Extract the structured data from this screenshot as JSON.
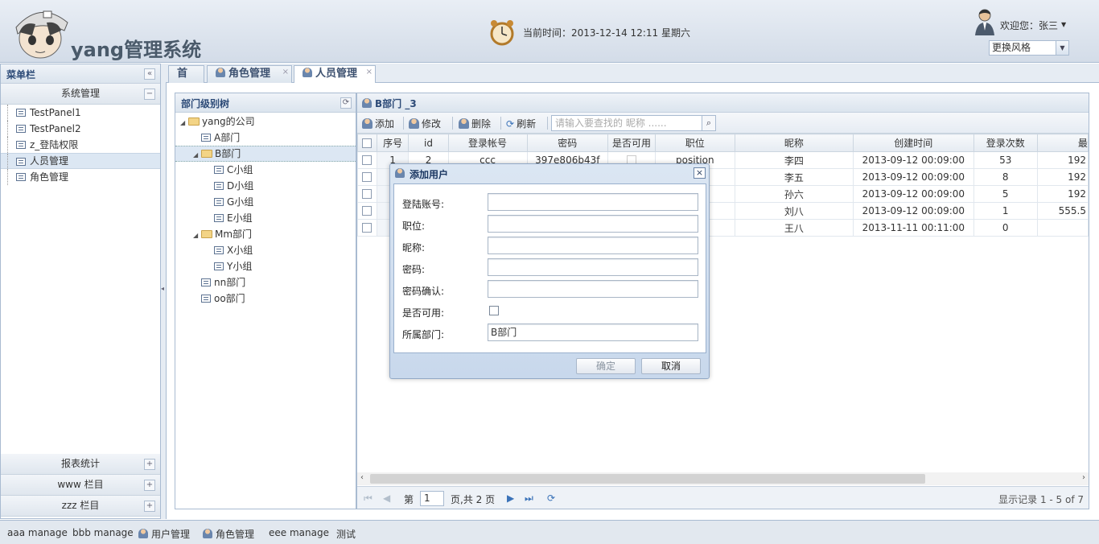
{
  "header": {
    "app_title": "yang管理系统",
    "time_text": "当前时间：2013-12-14 12:11 星期六",
    "welcome": "欢迎您：张三",
    "theme_select": "更换风格"
  },
  "menu": {
    "title": "菜单栏",
    "group_title": "系统管理",
    "items": [
      {
        "label": "TestPanel1"
      },
      {
        "label": "TestPanel2"
      },
      {
        "label": "z_登陆权限"
      },
      {
        "label": "人员管理"
      },
      {
        "label": "角色管理"
      }
    ],
    "accordions": [
      {
        "label": "报表统计"
      },
      {
        "label": "www 栏目"
      },
      {
        "label": "zzz 栏目"
      }
    ]
  },
  "tabs": [
    {
      "label": "首页"
    },
    {
      "label": "角色管理"
    },
    {
      "label": "人员管理"
    }
  ],
  "tree": {
    "title": "部门级别树",
    "nodes": [
      {
        "label": "yang的公司"
      },
      {
        "label": "A部门"
      },
      {
        "label": "B部门"
      },
      {
        "label": "C小组"
      },
      {
        "label": "D小组"
      },
      {
        "label": "G小组"
      },
      {
        "label": "E小组"
      },
      {
        "label": "Mm部门"
      },
      {
        "label": "X小组"
      },
      {
        "label": "Y小组"
      },
      {
        "label": "nn部门"
      },
      {
        "label": "oo部门"
      }
    ]
  },
  "grid": {
    "title": "B部门 _3",
    "toolbar": {
      "add": "添加",
      "edit": "修改",
      "delete": "删除",
      "refresh": "刷新",
      "search_placeholder": "请输入要查找的 昵称 ......"
    },
    "columns": [
      "序号",
      "id",
      "登录帐号",
      "密码",
      "是否可用",
      "职位",
      "昵称",
      "创建时间",
      "登录次数",
      "最"
    ],
    "rows": [
      {
        "no": "1",
        "id": "2",
        "account": "ccc",
        "password": "397e806b43f",
        "position": "position",
        "nickname": "李四",
        "created": "2013-09-12 00:09:00",
        "logins": "53",
        "last": "192"
      },
      {
        "no": "",
        "id": "",
        "account": "",
        "password": "",
        "position": "n",
        "nickname": "李五",
        "created": "2013-09-12 00:09:00",
        "logins": "8",
        "last": "192"
      },
      {
        "no": "",
        "id": "",
        "account": "",
        "password": "",
        "position": "n",
        "nickname": "孙六",
        "created": "2013-09-12 00:09:00",
        "logins": "5",
        "last": "192"
      },
      {
        "no": "",
        "id": "",
        "account": "",
        "password": "",
        "position": "n",
        "nickname": "刘八",
        "created": "2013-09-12 00:09:00",
        "logins": "1",
        "last": "555.5"
      },
      {
        "no": "",
        "id": "",
        "account": "",
        "password": "",
        "position": "n",
        "nickname": "王八",
        "created": "2013-11-11 00:11:00",
        "logins": "0",
        "last": ""
      }
    ],
    "pager": {
      "page_prefix": "第",
      "page_value": "1",
      "page_suffix": "页,共 2 页",
      "summary": "显示记录 1 - 5 of 7"
    }
  },
  "dialog": {
    "title": "添加用户",
    "fields": [
      {
        "label": "登陆账号:",
        "value": ""
      },
      {
        "label": "职位:",
        "value": ""
      },
      {
        "label": "昵称:",
        "value": ""
      },
      {
        "label": "密码:",
        "value": ""
      },
      {
        "label": "密码确认:",
        "value": ""
      }
    ],
    "enabled_label": "是否可用:",
    "dept_label": "所属部门:",
    "dept_value": "B部门",
    "ok": "确定",
    "cancel": "取消"
  },
  "footer": {
    "links": [
      "aaa manage",
      "bbb manage",
      "用户管理",
      "角色管理",
      "eee manage",
      "测试"
    ]
  }
}
